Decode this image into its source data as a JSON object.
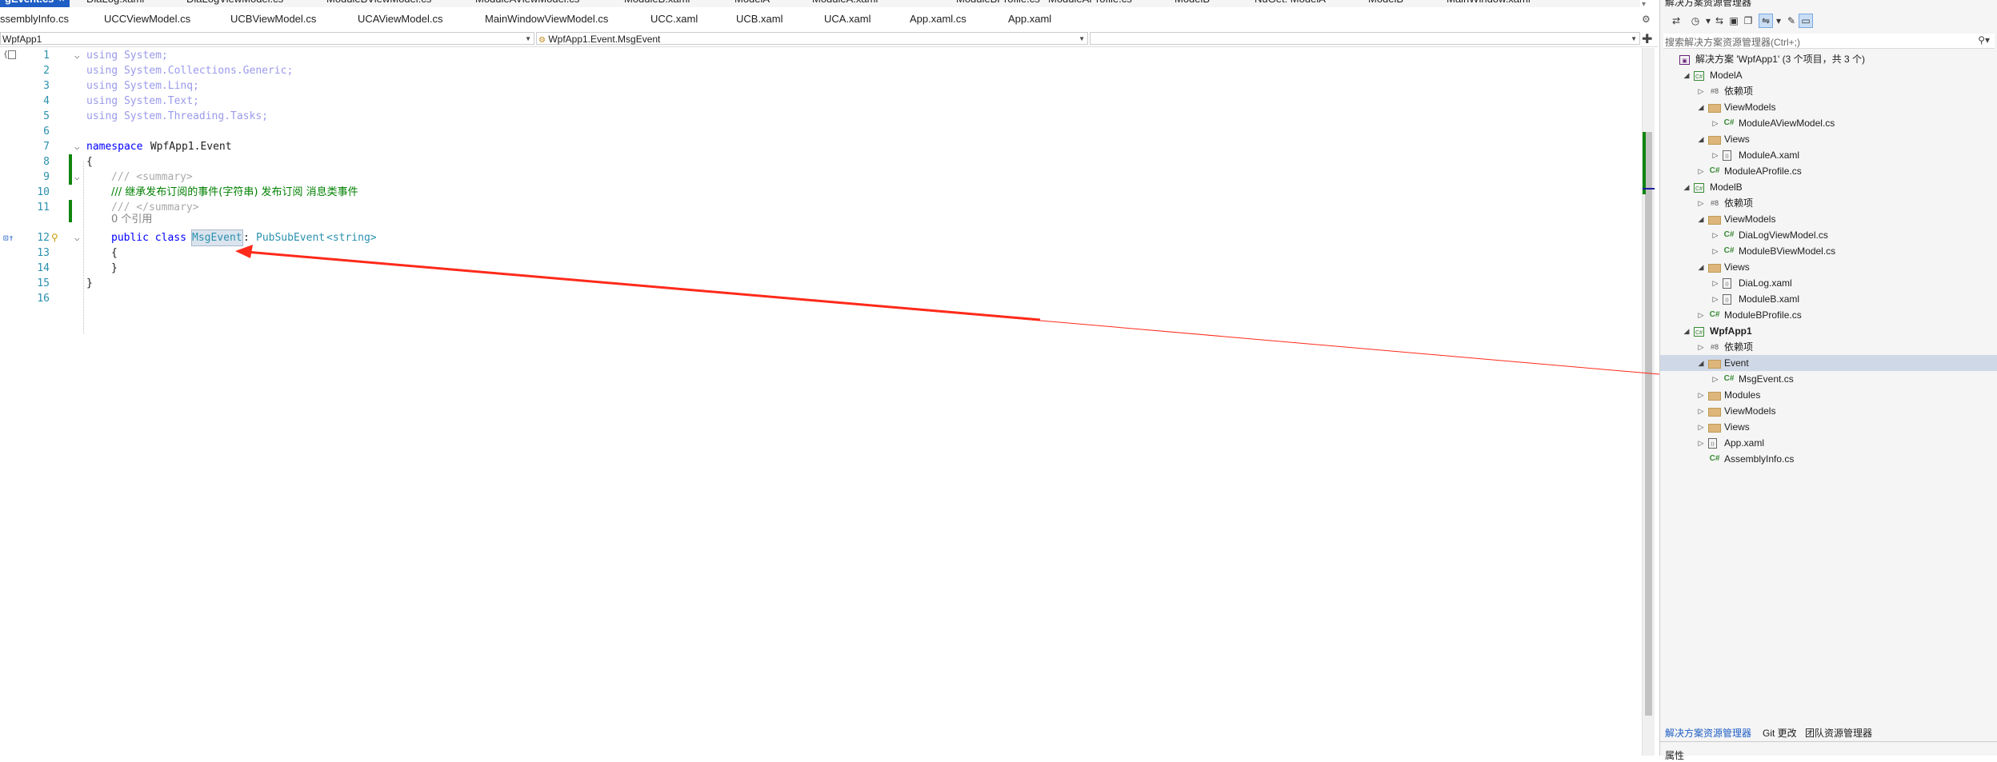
{
  "document_tabs_row1": [
    {
      "label": "gEvent.cs",
      "active": true,
      "close": "×"
    },
    {
      "label": "DiaLog.xaml"
    },
    {
      "label": "DiaLogViewModel.cs"
    },
    {
      "label": "ModuleBViewModel.cs"
    },
    {
      "label": "ModuleAViewModel.cs"
    },
    {
      "label": "ModuleB.xaml"
    },
    {
      "label": "ModelA"
    },
    {
      "label": "ModuleA.xaml"
    },
    {
      "label": "ModuleBProfile.cs"
    },
    {
      "label": "ModuleAProfile.cs"
    },
    {
      "label": "ModelB"
    },
    {
      "label": "NuGet: ModelA"
    },
    {
      "label": "ModelB"
    },
    {
      "label": "MainWindow.xaml"
    }
  ],
  "document_tabs_row2": [
    {
      "label": "ssemblyInfo.cs"
    },
    {
      "label": "UCCViewModel.cs"
    },
    {
      "label": "UCBViewModel.cs"
    },
    {
      "label": "UCAViewModel.cs"
    },
    {
      "label": "MainWindowViewModel.cs"
    },
    {
      "label": "UCC.xaml"
    },
    {
      "label": "UCB.xaml"
    },
    {
      "label": "UCA.xaml"
    },
    {
      "label": "App.xaml.cs"
    },
    {
      "label": "App.xaml"
    }
  ],
  "navbar": {
    "project": "WpfApp1",
    "type": "WpfApp1.Event.MsgEvent",
    "member": ""
  },
  "code": {
    "line_numbers": [
      "1",
      "2",
      "3",
      "4",
      "5",
      "6",
      "7",
      "8",
      "9",
      "10",
      "11",
      "12",
      "13",
      "14",
      "15",
      "16"
    ],
    "l1": "using System;",
    "l2": "using System.Collections.Generic;",
    "l3": "using System.Linq;",
    "l4": "using System.Text;",
    "l5": "using System.Threading.Tasks;",
    "l7_kw": "namespace",
    "l7_name": " WpfApp1.Event",
    "l8": "{",
    "l9": "/// <summary>",
    "l10": "/// 继承发布订阅的事件(字符串) 发布订阅 消息类事件",
    "l11": "/// </summary>",
    "refs": "0 个引用",
    "l12_kw": "public class ",
    "l12_name": "MsgEvent",
    "l12_colon": ": ",
    "l12_base": "PubSubEvent",
    "l12_generic": "<string>",
    "l13": "{",
    "l14": "}",
    "l15": "}"
  },
  "solution_explorer": {
    "title": "解决方案资源管理器",
    "search_placeholder": "搜索解决方案资源管理器(Ctrl+;)",
    "tree": [
      {
        "label": "解决方案 'WpfApp1' (3 个项目，共 3 个)",
        "icon": "solution-icon",
        "depth": 0,
        "expander": ""
      },
      {
        "label": "ModelA",
        "icon": "project-icon",
        "depth": 1,
        "expander": "◢"
      },
      {
        "label": "依赖项",
        "icon": "dependencies-icon",
        "depth": 2,
        "expander": "▷"
      },
      {
        "label": "ViewModels",
        "icon": "folder-icon",
        "depth": 2,
        "expander": "◢"
      },
      {
        "label": "ModuleAViewModel.cs",
        "icon": "csharp-file-icon",
        "depth": 3,
        "expander": "▷"
      },
      {
        "label": "Views",
        "icon": "folder-icon",
        "depth": 2,
        "expander": "◢"
      },
      {
        "label": "ModuleA.xaml",
        "icon": "xaml-file-icon",
        "depth": 3,
        "expander": "▷"
      },
      {
        "label": "ModuleAProfile.cs",
        "icon": "csharp-file-icon",
        "depth": 2,
        "expander": "▷"
      },
      {
        "label": "ModelB",
        "icon": "project-icon",
        "depth": 1,
        "expander": "◢"
      },
      {
        "label": "依赖项",
        "icon": "dependencies-icon",
        "depth": 2,
        "expander": "▷"
      },
      {
        "label": "ViewModels",
        "icon": "folder-icon",
        "depth": 2,
        "expander": "◢"
      },
      {
        "label": "DiaLogViewModel.cs",
        "icon": "csharp-file-icon",
        "depth": 3,
        "expander": "▷"
      },
      {
        "label": "ModuleBViewModel.cs",
        "icon": "csharp-file-icon",
        "depth": 3,
        "expander": "▷"
      },
      {
        "label": "Views",
        "icon": "folder-icon",
        "depth": 2,
        "expander": "◢"
      },
      {
        "label": "DiaLog.xaml",
        "icon": "xaml-file-icon",
        "depth": 3,
        "expander": "▷"
      },
      {
        "label": "ModuleB.xaml",
        "icon": "xaml-file-icon",
        "depth": 3,
        "expander": "▷"
      },
      {
        "label": "ModuleBProfile.cs",
        "icon": "csharp-file-icon",
        "depth": 2,
        "expander": "▷"
      },
      {
        "label": "WpfApp1",
        "icon": "project-icon",
        "depth": 1,
        "expander": "◢",
        "bold": true
      },
      {
        "label": "依赖项",
        "icon": "dependencies-icon",
        "depth": 2,
        "expander": "▷"
      },
      {
        "label": "Event",
        "icon": "folder-icon",
        "depth": 2,
        "expander": "◢",
        "selected": true
      },
      {
        "label": "MsgEvent.cs",
        "icon": "csharp-file-icon",
        "depth": 3,
        "expander": "▷"
      },
      {
        "label": "Modules",
        "icon": "folder-icon",
        "depth": 2,
        "expander": "▷"
      },
      {
        "label": "ViewModels",
        "icon": "folder-icon",
        "depth": 2,
        "expander": "▷"
      },
      {
        "label": "Views",
        "icon": "folder-icon",
        "depth": 2,
        "expander": "▷"
      },
      {
        "label": "App.xaml",
        "icon": "xaml-file-icon",
        "depth": 2,
        "expander": "▷"
      },
      {
        "label": "AssemblyInfo.cs",
        "icon": "csharp-file-icon",
        "depth": 2,
        "expander": ""
      }
    ],
    "bottom_tabs": [
      "解决方案资源管理器",
      "Git 更改",
      "团队资源管理器"
    ],
    "properties_title": "属性"
  },
  "colors": {
    "active_tab": "#1f5ec4",
    "keyword": "#0000ff",
    "type": "#2b91af",
    "comment": "#008000",
    "arrow": "#ff0000",
    "change_bar": "#108510"
  }
}
